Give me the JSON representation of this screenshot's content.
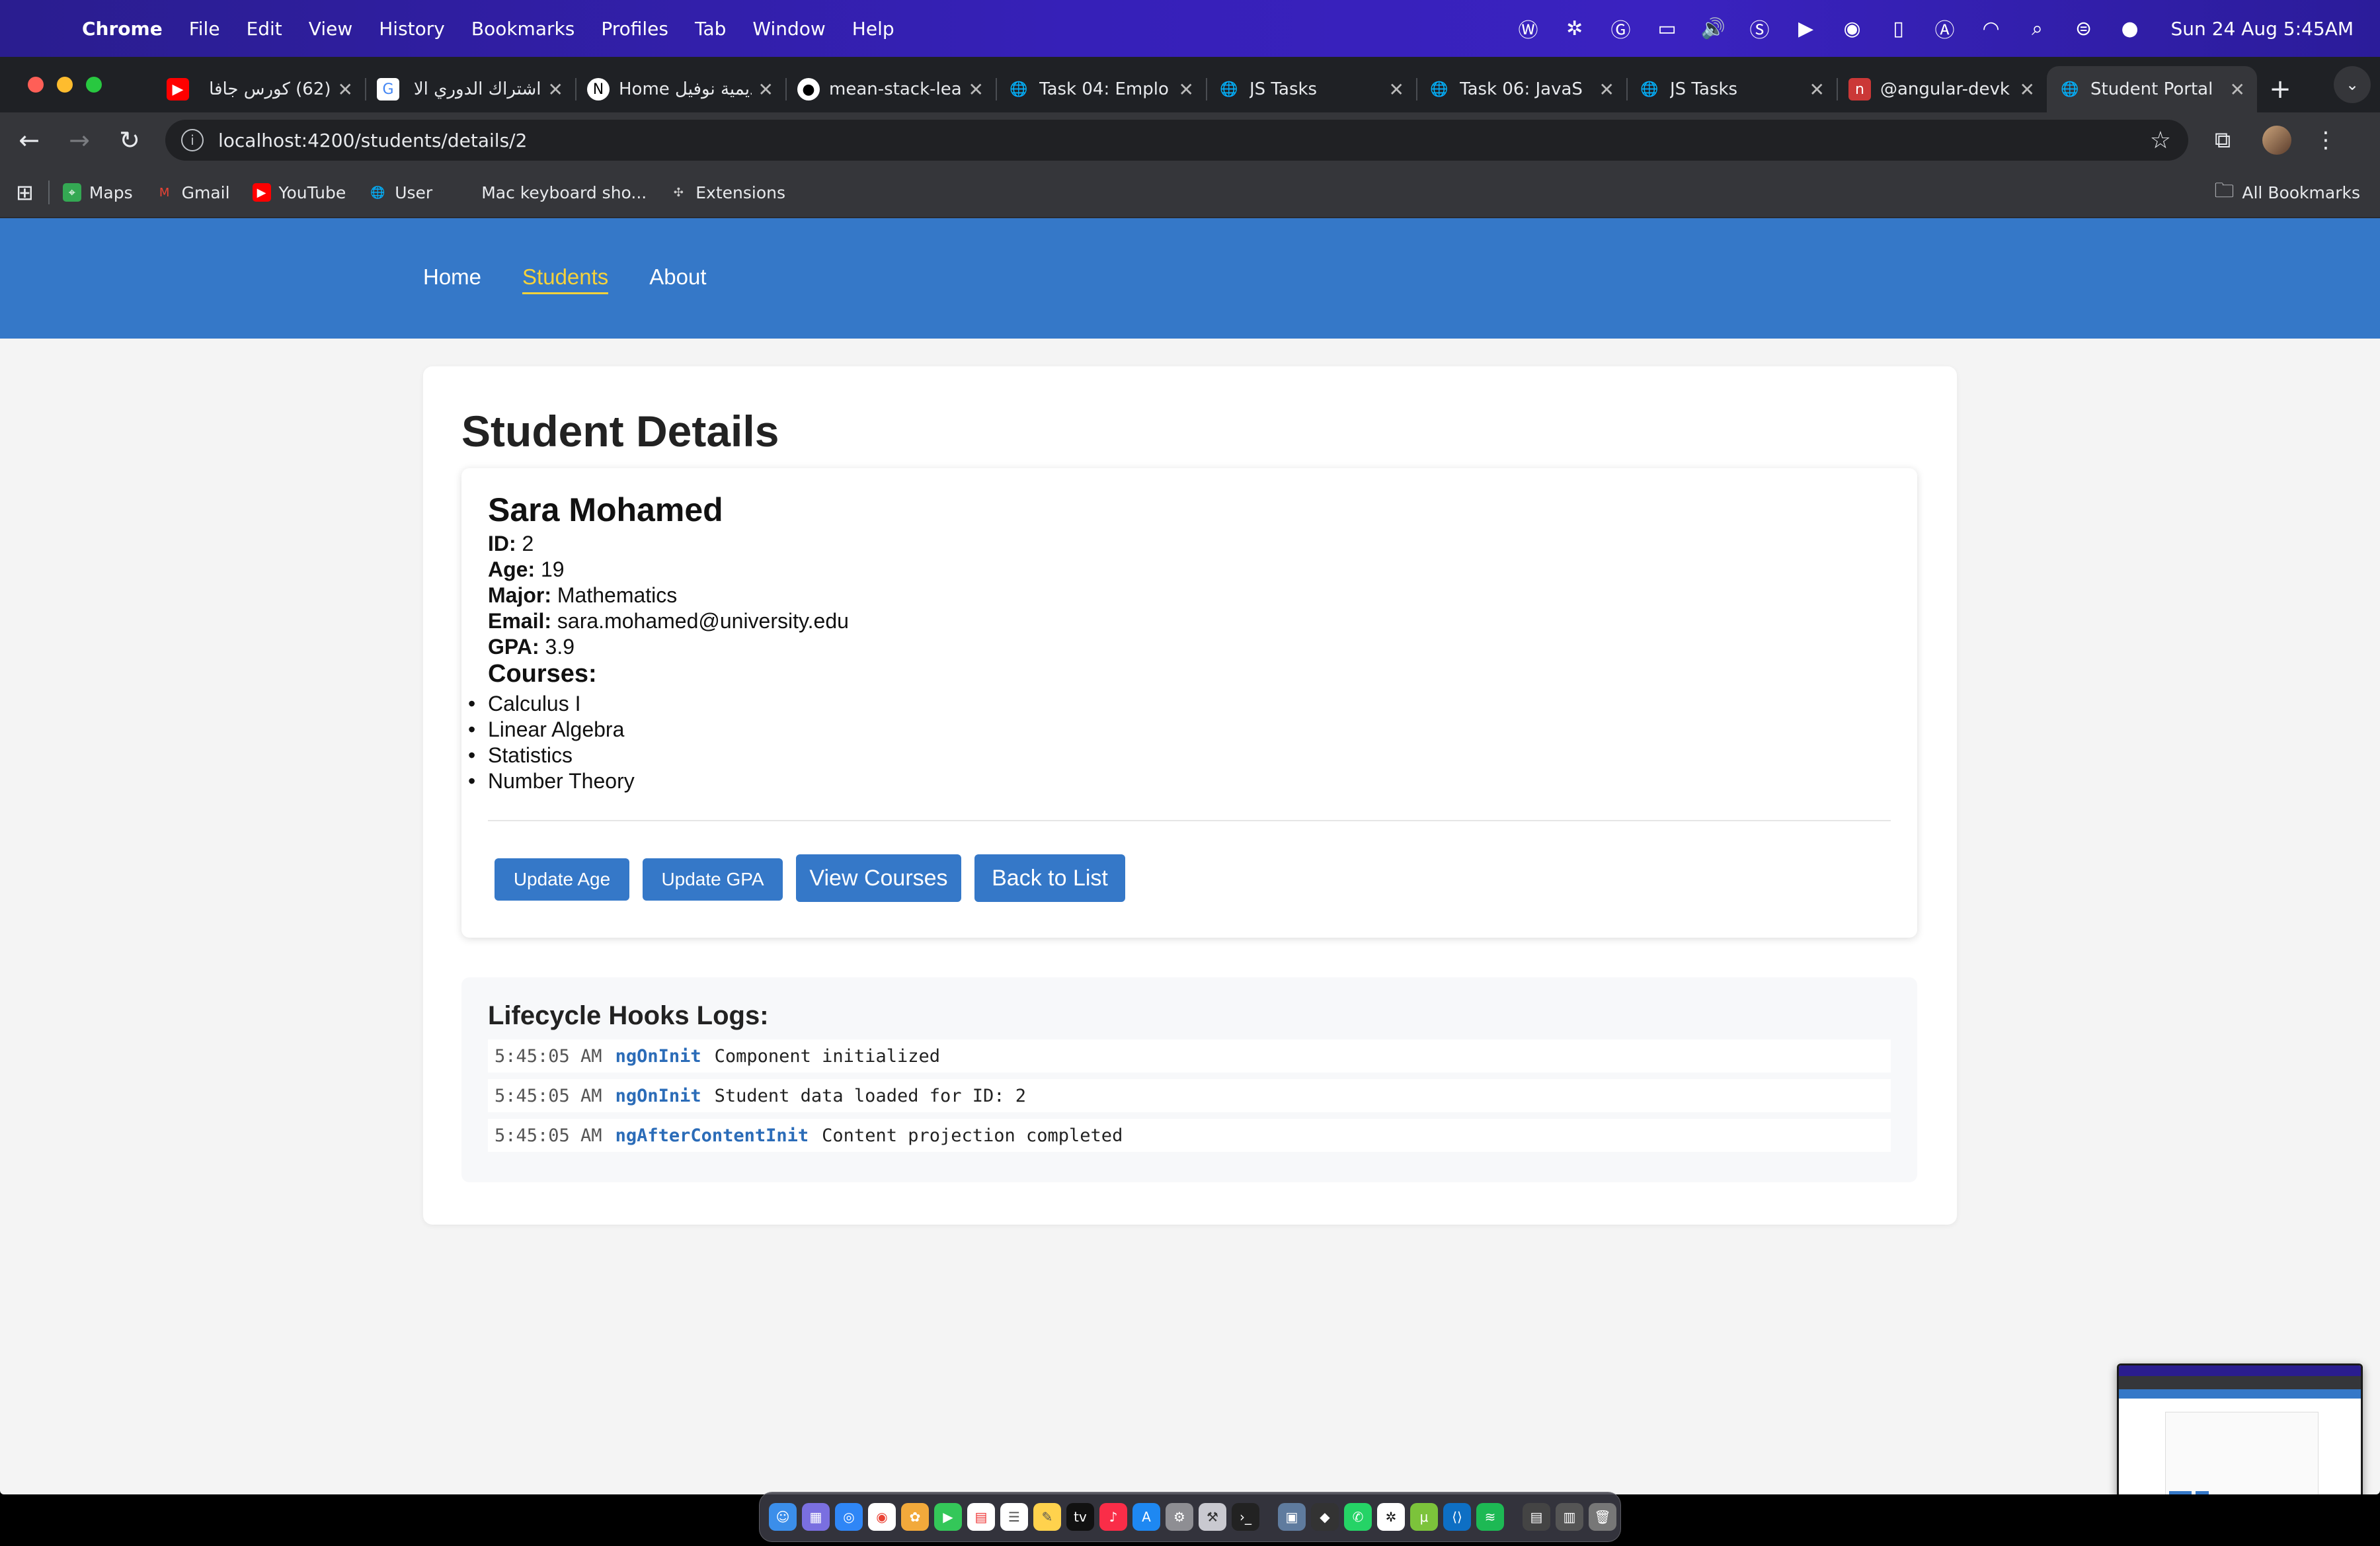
{
  "menubar": {
    "app": "Chrome",
    "items": [
      "File",
      "Edit",
      "View",
      "History",
      "Bookmarks",
      "Profiles",
      "Tab",
      "Window",
      "Help"
    ],
    "clock": "Sun 24 Aug  5:45AM"
  },
  "tabs": [
    {
      "label": "(62) كورس جافا",
      "icon": "youtube-icon",
      "color": "#ff0000"
    },
    {
      "label": "اشتراك الدوري الا",
      "icon": "google-icon",
      "color": "#ffffff"
    },
    {
      "label": "Home أكاديمية نوفيل",
      "icon": "notion-icon",
      "color": "#ffffff"
    },
    {
      "label": "mean-stack-lea",
      "icon": "github-icon",
      "color": "#ffffff"
    },
    {
      "label": "Task 04: Emplo",
      "icon": "globe-icon",
      "color": "#cccccc"
    },
    {
      "label": "JS Tasks",
      "icon": "globe-icon",
      "color": "#cccccc"
    },
    {
      "label": "Task 06: JavaS",
      "icon": "globe-icon",
      "color": "#cccccc"
    },
    {
      "label": "JS Tasks",
      "icon": "globe-icon",
      "color": "#cccccc"
    },
    {
      "label": "@angular-devk",
      "icon": "npm-icon",
      "color": "#cb3837"
    },
    {
      "label": "Student Portal",
      "icon": "globe-icon",
      "color": "#cccccc",
      "active": true
    }
  ],
  "address_bar": {
    "url": "localhost:4200/students/details/2"
  },
  "bookmarks": {
    "items": [
      {
        "label": "Maps",
        "icon": "maps-icon"
      },
      {
        "label": "Gmail",
        "icon": "gmail-icon"
      },
      {
        "label": "YouTube",
        "icon": "youtube-icon"
      },
      {
        "label": "User",
        "icon": "globe-icon"
      },
      {
        "label": "Mac keyboard sho...",
        "icon": "apple-icon"
      },
      {
        "label": "Extensions",
        "icon": "puzzle-icon"
      }
    ],
    "all_label": "All Bookmarks"
  },
  "app_nav": {
    "home": "Home",
    "students": "Students",
    "about": "About"
  },
  "page": {
    "title": "Student Details"
  },
  "student": {
    "name": "Sara Mohamed",
    "id_label": "ID:",
    "id": "2",
    "age_label": "Age:",
    "age": "19",
    "major_label": "Major:",
    "major": "Mathematics",
    "email_label": "Email:",
    "email": "sara.mohamed@university.edu",
    "gpa_label": "GPA:",
    "gpa": "3.9",
    "courses_label": "Courses:",
    "courses": [
      "Calculus I",
      "Linear Algebra",
      "Statistics",
      "Number Theory"
    ]
  },
  "actions": {
    "update_age": "Update Age",
    "update_gpa": "Update GPA",
    "view_courses": "View Courses",
    "back_to_list": "Back to List"
  },
  "logs": {
    "title": "Lifecycle Hooks Logs:",
    "entries": [
      {
        "time": "5:45:05 AM",
        "hook": "ngOnInit",
        "message": "Component initialized"
      },
      {
        "time": "5:45:05 AM",
        "hook": "ngOnInit",
        "message": "Student data loaded for ID: 2"
      },
      {
        "time": "5:45:05 AM",
        "hook": "ngAfterContentInit",
        "message": "Content projection completed"
      }
    ]
  },
  "colors": {
    "header_blue": "#3578c8",
    "active_nav": "#f6d23a",
    "button_blue": "#3578c8",
    "hook_blue": "#2b6cb8"
  }
}
